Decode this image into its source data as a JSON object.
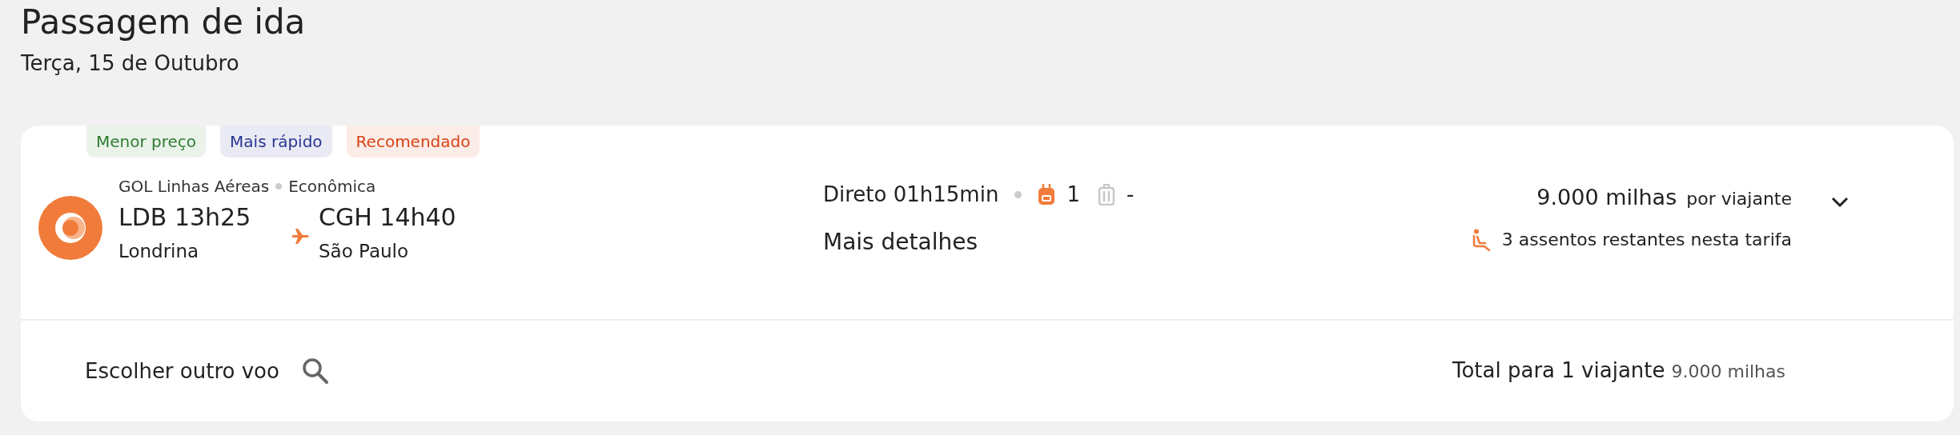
{
  "header": {
    "title": "Passagem de ida",
    "date": "Terça, 15 de Outubro"
  },
  "flight": {
    "tags": [
      {
        "label": "Menor preço",
        "color": "#2e7d32"
      },
      {
        "label": "Mais rápido",
        "color": "#283593"
      },
      {
        "label": "Recomendado",
        "color": "#d84315"
      }
    ],
    "airline": "GOL Linhas Aéreas",
    "cabin": "Econômica",
    "departure": {
      "code_time": "LDB 13h25",
      "city": "Londrina"
    },
    "arrival": {
      "code_time": "CGH 14h40",
      "city": "São Paulo"
    },
    "duration": "Direto 01h15min",
    "baggage": [
      {
        "kind": "backpack",
        "count": "1",
        "included": true
      },
      {
        "kind": "suitcase",
        "count": "-",
        "included": false
      }
    ],
    "details_link": "Mais detalhes",
    "price": "9.000 milhas",
    "price_unit": "por viajante",
    "seats": "3 assentos restantes nesta tarifa",
    "expanded": false
  },
  "footer": {
    "choose_other": "Escolher outro voo",
    "total_label": "Total para 1 viajante",
    "total_value": "9.000 milhas"
  }
}
